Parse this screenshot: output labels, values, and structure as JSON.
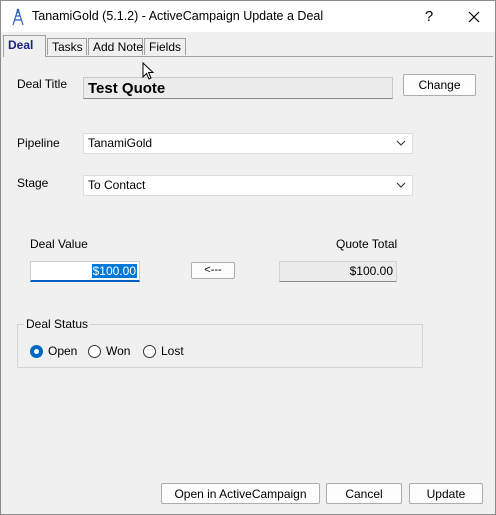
{
  "window": {
    "title": "TanamiGold (5.1.2) - ActiveCampaign Update a Deal",
    "help_glyph": "?",
    "close_glyph": "✕",
    "icons": {
      "app": "tanamigold-app-icon",
      "close": "close-icon"
    }
  },
  "tabs": [
    {
      "label": "Deal",
      "active": true
    },
    {
      "label": "Tasks",
      "active": false
    },
    {
      "label": "Add Note",
      "active": false
    },
    {
      "label": "Fields",
      "active": false
    }
  ],
  "deal": {
    "title_label": "Deal Title",
    "title_value": "Test Quote",
    "change_button": "Change",
    "pipeline_label": "Pipeline",
    "pipeline_value": "TanamiGold",
    "stage_label": "Stage",
    "stage_value": "To Contact",
    "deal_value_label": "Deal Value",
    "deal_value": "$100.00",
    "copy_button": "<---",
    "quote_total_label": "Quote Total",
    "quote_total": "$100.00"
  },
  "status": {
    "group_label": "Deal Status",
    "options": [
      {
        "label": "Open",
        "selected": true
      },
      {
        "label": "Won",
        "selected": false
      },
      {
        "label": "Lost",
        "selected": false
      }
    ]
  },
  "footer": {
    "open_button": "Open in ActiveCampaign",
    "cancel_button": "Cancel",
    "update_button": "Update"
  },
  "colors": {
    "accent": "#0067c0",
    "selection": "#0078d7",
    "active_tab_text": "#1a237e",
    "window_bg": "#f0f0f0"
  }
}
